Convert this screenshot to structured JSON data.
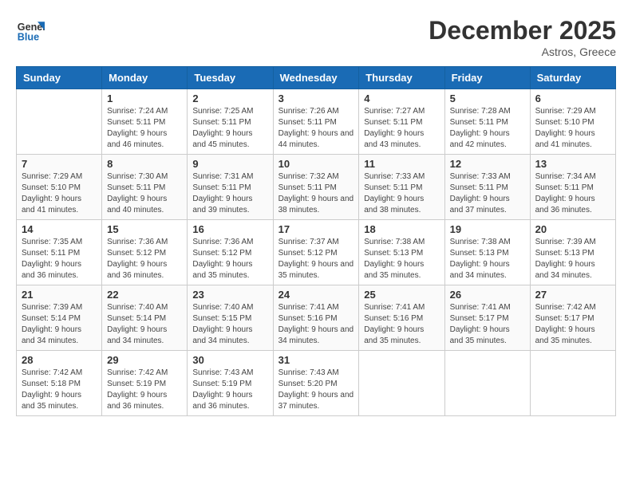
{
  "header": {
    "logo_general": "General",
    "logo_blue": "Blue",
    "month_year": "December 2025",
    "location": "Astros, Greece"
  },
  "weekdays": [
    "Sunday",
    "Monday",
    "Tuesday",
    "Wednesday",
    "Thursday",
    "Friday",
    "Saturday"
  ],
  "weeks": [
    [
      {
        "day": "",
        "sunrise": "",
        "sunset": "",
        "daylight": ""
      },
      {
        "day": "1",
        "sunrise": "Sunrise: 7:24 AM",
        "sunset": "Sunset: 5:11 PM",
        "daylight": "Daylight: 9 hours and 46 minutes."
      },
      {
        "day": "2",
        "sunrise": "Sunrise: 7:25 AM",
        "sunset": "Sunset: 5:11 PM",
        "daylight": "Daylight: 9 hours and 45 minutes."
      },
      {
        "day": "3",
        "sunrise": "Sunrise: 7:26 AM",
        "sunset": "Sunset: 5:11 PM",
        "daylight": "Daylight: 9 hours and 44 minutes."
      },
      {
        "day": "4",
        "sunrise": "Sunrise: 7:27 AM",
        "sunset": "Sunset: 5:11 PM",
        "daylight": "Daylight: 9 hours and 43 minutes."
      },
      {
        "day": "5",
        "sunrise": "Sunrise: 7:28 AM",
        "sunset": "Sunset: 5:11 PM",
        "daylight": "Daylight: 9 hours and 42 minutes."
      },
      {
        "day": "6",
        "sunrise": "Sunrise: 7:29 AM",
        "sunset": "Sunset: 5:10 PM",
        "daylight": "Daylight: 9 hours and 41 minutes."
      }
    ],
    [
      {
        "day": "7",
        "sunrise": "Sunrise: 7:29 AM",
        "sunset": "Sunset: 5:10 PM",
        "daylight": "Daylight: 9 hours and 41 minutes."
      },
      {
        "day": "8",
        "sunrise": "Sunrise: 7:30 AM",
        "sunset": "Sunset: 5:11 PM",
        "daylight": "Daylight: 9 hours and 40 minutes."
      },
      {
        "day": "9",
        "sunrise": "Sunrise: 7:31 AM",
        "sunset": "Sunset: 5:11 PM",
        "daylight": "Daylight: 9 hours and 39 minutes."
      },
      {
        "day": "10",
        "sunrise": "Sunrise: 7:32 AM",
        "sunset": "Sunset: 5:11 PM",
        "daylight": "Daylight: 9 hours and 38 minutes."
      },
      {
        "day": "11",
        "sunrise": "Sunrise: 7:33 AM",
        "sunset": "Sunset: 5:11 PM",
        "daylight": "Daylight: 9 hours and 38 minutes."
      },
      {
        "day": "12",
        "sunrise": "Sunrise: 7:33 AM",
        "sunset": "Sunset: 5:11 PM",
        "daylight": "Daylight: 9 hours and 37 minutes."
      },
      {
        "day": "13",
        "sunrise": "Sunrise: 7:34 AM",
        "sunset": "Sunset: 5:11 PM",
        "daylight": "Daylight: 9 hours and 36 minutes."
      }
    ],
    [
      {
        "day": "14",
        "sunrise": "Sunrise: 7:35 AM",
        "sunset": "Sunset: 5:11 PM",
        "daylight": "Daylight: 9 hours and 36 minutes."
      },
      {
        "day": "15",
        "sunrise": "Sunrise: 7:36 AM",
        "sunset": "Sunset: 5:12 PM",
        "daylight": "Daylight: 9 hours and 36 minutes."
      },
      {
        "day": "16",
        "sunrise": "Sunrise: 7:36 AM",
        "sunset": "Sunset: 5:12 PM",
        "daylight": "Daylight: 9 hours and 35 minutes."
      },
      {
        "day": "17",
        "sunrise": "Sunrise: 7:37 AM",
        "sunset": "Sunset: 5:12 PM",
        "daylight": "Daylight: 9 hours and 35 minutes."
      },
      {
        "day": "18",
        "sunrise": "Sunrise: 7:38 AM",
        "sunset": "Sunset: 5:13 PM",
        "daylight": "Daylight: 9 hours and 35 minutes."
      },
      {
        "day": "19",
        "sunrise": "Sunrise: 7:38 AM",
        "sunset": "Sunset: 5:13 PM",
        "daylight": "Daylight: 9 hours and 34 minutes."
      },
      {
        "day": "20",
        "sunrise": "Sunrise: 7:39 AM",
        "sunset": "Sunset: 5:13 PM",
        "daylight": "Daylight: 9 hours and 34 minutes."
      }
    ],
    [
      {
        "day": "21",
        "sunrise": "Sunrise: 7:39 AM",
        "sunset": "Sunset: 5:14 PM",
        "daylight": "Daylight: 9 hours and 34 minutes."
      },
      {
        "day": "22",
        "sunrise": "Sunrise: 7:40 AM",
        "sunset": "Sunset: 5:14 PM",
        "daylight": "Daylight: 9 hours and 34 minutes."
      },
      {
        "day": "23",
        "sunrise": "Sunrise: 7:40 AM",
        "sunset": "Sunset: 5:15 PM",
        "daylight": "Daylight: 9 hours and 34 minutes."
      },
      {
        "day": "24",
        "sunrise": "Sunrise: 7:41 AM",
        "sunset": "Sunset: 5:16 PM",
        "daylight": "Daylight: 9 hours and 34 minutes."
      },
      {
        "day": "25",
        "sunrise": "Sunrise: 7:41 AM",
        "sunset": "Sunset: 5:16 PM",
        "daylight": "Daylight: 9 hours and 35 minutes."
      },
      {
        "day": "26",
        "sunrise": "Sunrise: 7:41 AM",
        "sunset": "Sunset: 5:17 PM",
        "daylight": "Daylight: 9 hours and 35 minutes."
      },
      {
        "day": "27",
        "sunrise": "Sunrise: 7:42 AM",
        "sunset": "Sunset: 5:17 PM",
        "daylight": "Daylight: 9 hours and 35 minutes."
      }
    ],
    [
      {
        "day": "28",
        "sunrise": "Sunrise: 7:42 AM",
        "sunset": "Sunset: 5:18 PM",
        "daylight": "Daylight: 9 hours and 35 minutes."
      },
      {
        "day": "29",
        "sunrise": "Sunrise: 7:42 AM",
        "sunset": "Sunset: 5:19 PM",
        "daylight": "Daylight: 9 hours and 36 minutes."
      },
      {
        "day": "30",
        "sunrise": "Sunrise: 7:43 AM",
        "sunset": "Sunset: 5:19 PM",
        "daylight": "Daylight: 9 hours and 36 minutes."
      },
      {
        "day": "31",
        "sunrise": "Sunrise: 7:43 AM",
        "sunset": "Sunset: 5:20 PM",
        "daylight": "Daylight: 9 hours and 37 minutes."
      },
      {
        "day": "",
        "sunrise": "",
        "sunset": "",
        "daylight": ""
      },
      {
        "day": "",
        "sunrise": "",
        "sunset": "",
        "daylight": ""
      },
      {
        "day": "",
        "sunrise": "",
        "sunset": "",
        "daylight": ""
      }
    ]
  ]
}
